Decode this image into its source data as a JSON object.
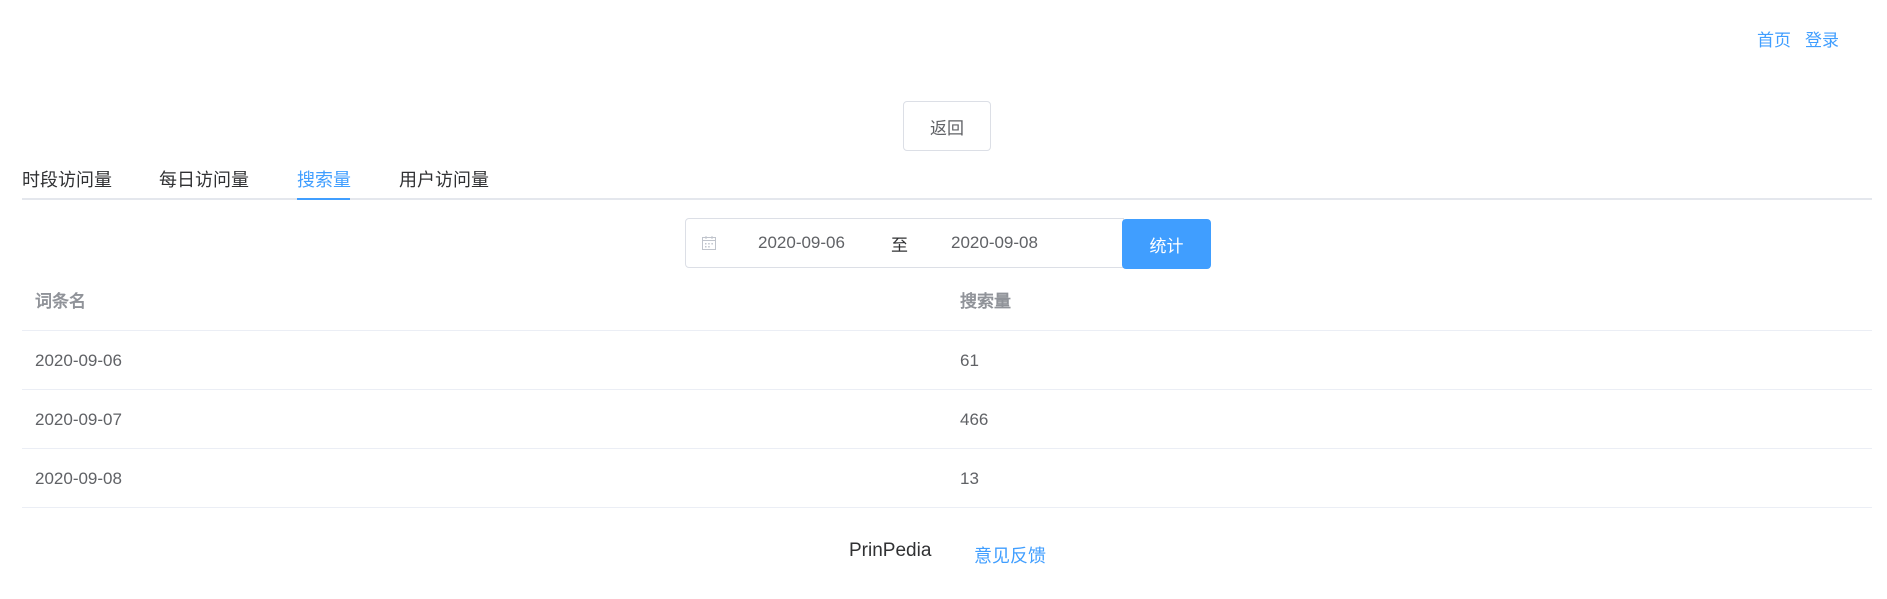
{
  "topnav": {
    "home": "首页",
    "login": "登录"
  },
  "back_label": "返回",
  "tabs": [
    {
      "label": "时段访问量"
    },
    {
      "label": "每日访问量"
    },
    {
      "label": "搜索量"
    },
    {
      "label": "用户访问量"
    }
  ],
  "active_tab": "搜索量",
  "date_range": {
    "start": "2020-09-06",
    "separator": "至",
    "end": "2020-09-08"
  },
  "stat_button": "统计",
  "table": {
    "headers": [
      "词条名",
      "搜索量"
    ],
    "rows": [
      [
        "2020-09-06",
        "61"
      ],
      [
        "2020-09-07",
        "466"
      ],
      [
        "2020-09-08",
        "13"
      ]
    ]
  },
  "footer": {
    "brand": "PrinPedia",
    "feedback": "意见反馈"
  },
  "colors": {
    "primary": "#409eff",
    "border": "#dcdfe6"
  },
  "icons": {
    "date_range": "calendar-icon"
  }
}
